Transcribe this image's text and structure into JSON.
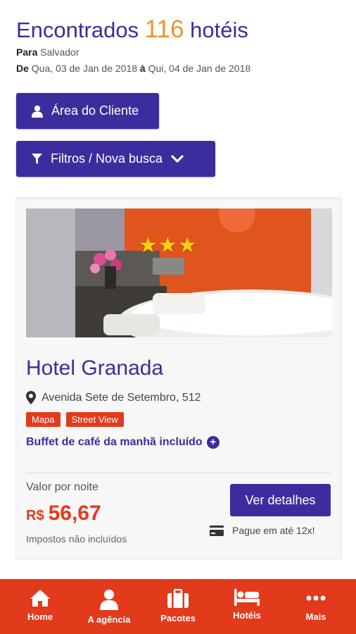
{
  "header": {
    "title_prefix": "Encontrados",
    "count": "116",
    "title_suffix": "hotéis",
    "destination_label": "Para",
    "destination": "Salvador",
    "dates_label": "De",
    "date_from": "Qua, 03 de Jan de 2018",
    "date_sep": "à",
    "date_to": "Qui, 04 de Jan de 2018"
  },
  "buttons": {
    "cliente": "Área do Cliente",
    "filtros": "Filtros / Nova busca"
  },
  "hotel": {
    "name": "Hotel Granada",
    "stars": "★★★",
    "star_count": 3,
    "address": "Avenida Sete de Setembro, 512",
    "tags": [
      "Mapa",
      "Street View"
    ],
    "breakfast": "Buffet de café da manhã incluído",
    "price_label": "Valor por noite",
    "currency": "R$",
    "price": "56,67",
    "taxes": "Impostos não incluídos",
    "details_button": "Ver detalhes",
    "installments": "Pague em até 12x!"
  },
  "nav": {
    "items": [
      "Home",
      "A agência",
      "Pacotes",
      "Hotéis",
      "Mais"
    ]
  },
  "colors": {
    "primary": "#3c2d9e",
    "accent": "#f39224",
    "brand_red": "#e13b1c"
  }
}
